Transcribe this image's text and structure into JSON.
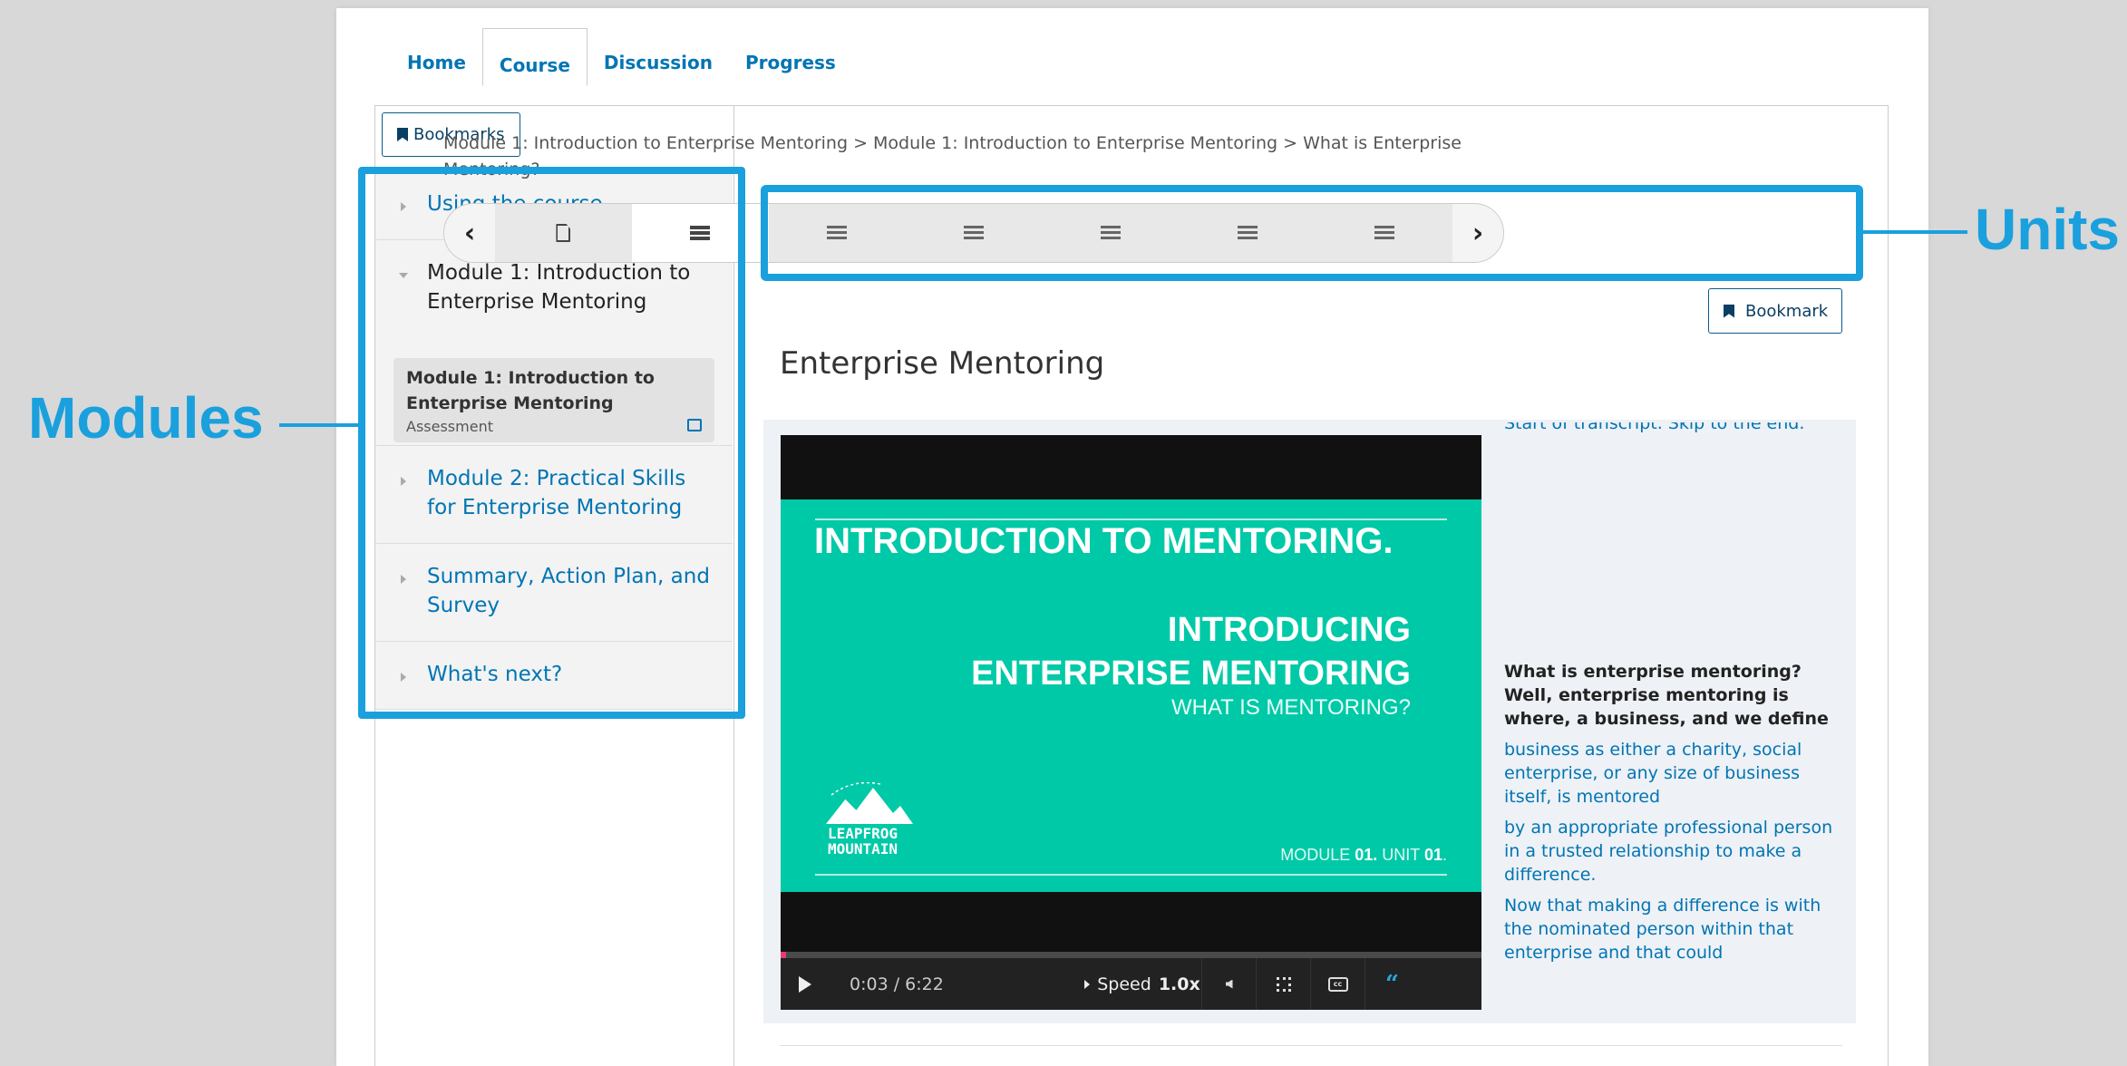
{
  "topnav": {
    "home": "Home",
    "course": "Course",
    "discussion": "Discussion",
    "progress": "Progress"
  },
  "sidebar": {
    "bookmarks_label": "Bookmarks",
    "sections": [
      {
        "title": "Using the course"
      },
      {
        "title": "Module 1: Introduction to Enterprise Mentoring",
        "subsection": {
          "title": "Module 1: Introduction to Enterprise Mentoring",
          "meta": "Assessment"
        }
      },
      {
        "title": "Module 2: Practical Skills for Enterprise Mentoring"
      },
      {
        "title": "Summary, Action Plan, and Survey"
      },
      {
        "title": "What's next?"
      }
    ]
  },
  "breadcrumb": "Module 1: Introduction to Enterprise Mentoring > Module 1: Introduction to Enterprise Mentoring > What is Enterprise Mentoring?",
  "sequence": {
    "prev_icon": "chevron-left-icon",
    "next_icon": "chevron-right-icon",
    "prev": "‹",
    "next": "›",
    "units": [
      "doc",
      "list",
      "list",
      "list",
      "list",
      "list",
      "list"
    ],
    "active_index": 1
  },
  "bookmark_button": "Bookmark",
  "unit_title": "Enterprise Mentoring",
  "video": {
    "slide_title": "INTRODUCTION TO MENTORING.",
    "slide_heading_1": "INTRODUCING",
    "slide_heading_2": "ENTERPRISE MENTORING",
    "slide_sub": "WHAT IS MENTORING?",
    "module_prefix": "MODULE ",
    "module_num": "01.",
    "unit_prefix": " UNIT ",
    "unit_num": "01",
    "module_suffix": ".",
    "logo_line1": "LEAPFROG",
    "logo_line2": "MOUNTAIN",
    "time": "0:03 / 6:22",
    "speed_label": "Speed",
    "speed_value": "1.0x",
    "progress_percent": 0.8,
    "accent": "#e73b76",
    "slide_color": "#00c9a7"
  },
  "transcript": {
    "skip": "Start of transcript. Skip to the end.",
    "current": "What is enterprise mentoring? Well, enterprise mentoring is where, a business, and we define",
    "lines": [
      "business as either a charity, social enterprise, or any size of business itself, is mentored",
      "by an appropriate professional person in a trusted relationship to make a difference.",
      "Now that making a difference is with the nominated person within that enterprise and that could"
    ]
  },
  "annotations": {
    "modules": "Modules",
    "units": "Units",
    "color": "#1aa0dd"
  }
}
